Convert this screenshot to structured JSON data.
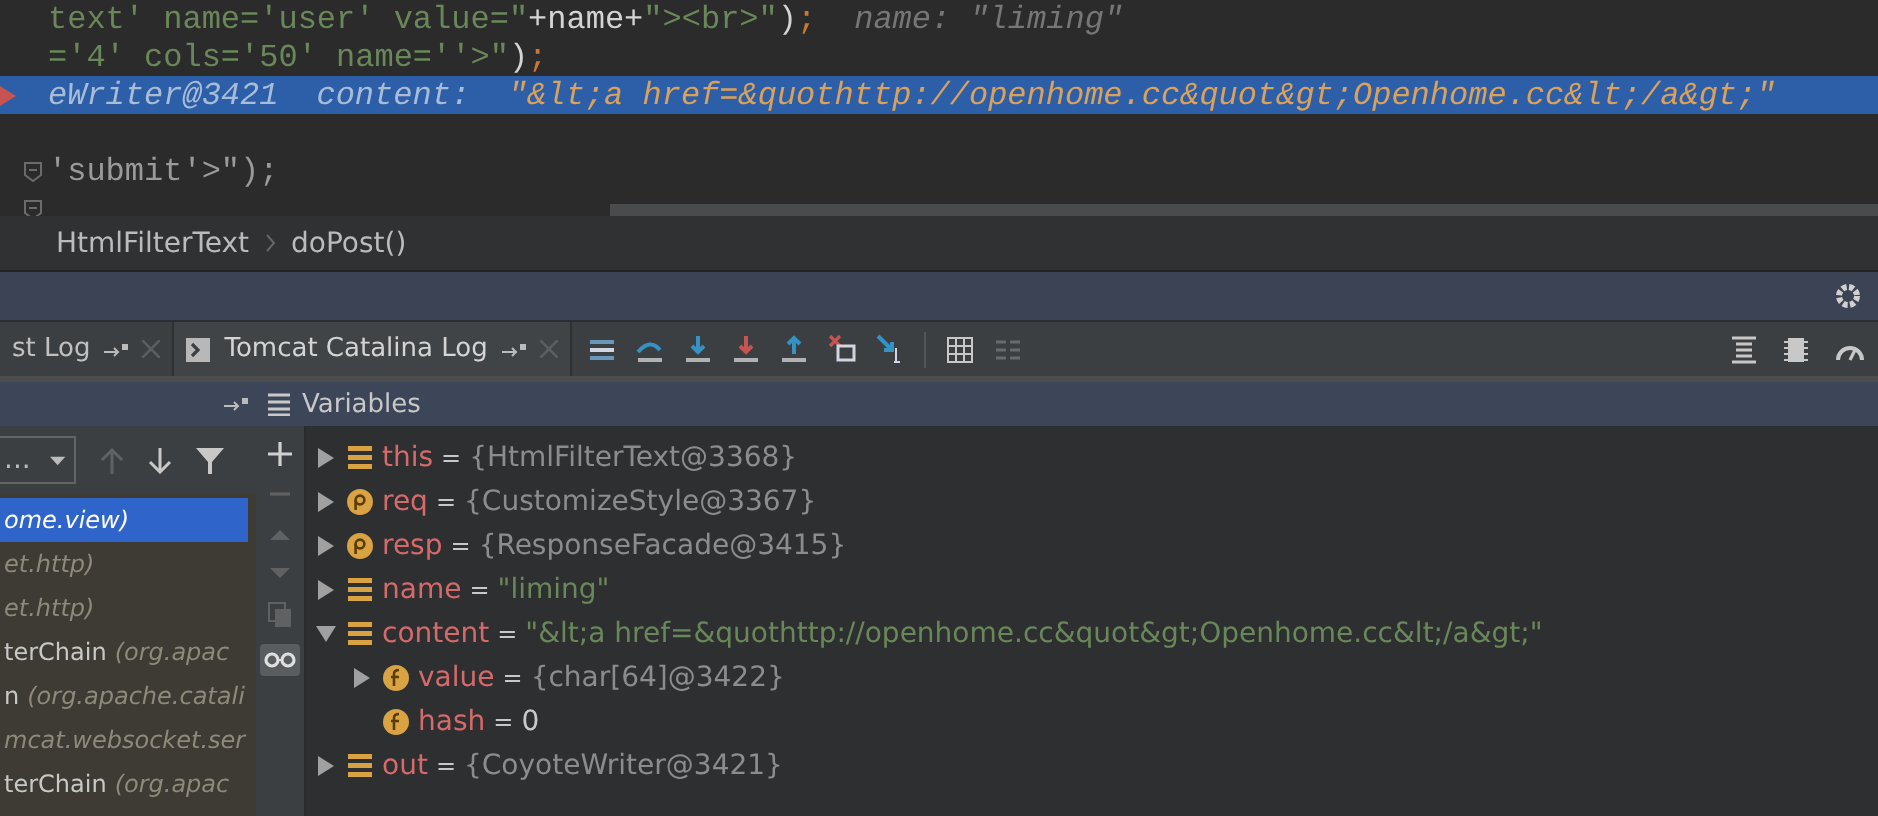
{
  "editor": {
    "lines": [
      {
        "selected": false,
        "breakpoint": false,
        "fold": false,
        "segments": [
          {
            "text": "text' name='user' value=\"",
            "kind": "string"
          },
          {
            "text": "+name+",
            "kind": "code"
          },
          {
            "text": "\"><br>\"",
            "kind": "string"
          },
          {
            "text": ")",
            "kind": "code"
          },
          {
            "text": ";",
            "kind": "punct"
          },
          {
            "text": "name: \"liming\"",
            "kind": "hint"
          }
        ]
      },
      {
        "selected": false,
        "breakpoint": false,
        "fold": false,
        "segments": [
          {
            "text": "='4' cols='50' name=''>\"",
            "kind": "string"
          },
          {
            "text": ")",
            "kind": "code"
          },
          {
            "text": ";",
            "kind": "punct"
          }
        ]
      },
      {
        "selected": true,
        "breakpoint": true,
        "fold": false,
        "segments": [
          {
            "text": "eWriter@3421",
            "kind": "debug-label"
          },
          {
            "text": "content:",
            "kind": "debug-label"
          },
          {
            "text": "\"&lt;a href=&quothttp://openhome.cc&quot&gt;Openhome.cc&lt;/a&gt;\"",
            "kind": "debug-value"
          }
        ]
      },
      {
        "selected": false,
        "breakpoint": false,
        "fold": false
      },
      {
        "selected": false,
        "breakpoint": false,
        "fold": true,
        "segments": [
          {
            "text": "'submit'>\");",
            "kind": "dim"
          }
        ]
      },
      {
        "selected": false,
        "breakpoint": false,
        "fold": true
      }
    ]
  },
  "breadcrumb": [
    "HtmlFilterText",
    "doPost()"
  ],
  "tabs": [
    {
      "label": "st Log",
      "selected": false,
      "console": false
    },
    {
      "label": "Tomcat Catalina Log",
      "selected": true,
      "console": true
    }
  ],
  "frames": {
    "dropdown": "...",
    "items": [
      {
        "location": "ome.view)",
        "selected": true
      },
      {
        "location": "et.http)",
        "selected": false
      },
      {
        "location": "et.http)",
        "selected": false
      },
      {
        "method": "terChain",
        "location": "(org.apac",
        "selected": false
      },
      {
        "method": "n",
        "location": "(org.apache.catali",
        "selected": false
      },
      {
        "location": "mcat.websocket.ser",
        "selected": false
      },
      {
        "method": "terChain",
        "location": "(org.apac",
        "selected": false
      }
    ]
  },
  "variables": {
    "title": "Variables",
    "items": [
      {
        "kind": "field",
        "name": "this",
        "equals": "=",
        "value": {
          "text": "{HtmlFilterText@3368}",
          "kind": "object"
        },
        "expanded": false
      },
      {
        "kind": "param",
        "name": "req",
        "equals": "=",
        "value": {
          "text": "{CustomizeStyle@3367}",
          "kind": "object"
        },
        "expanded": false
      },
      {
        "kind": "param",
        "name": "resp",
        "equals": "=",
        "value": {
          "text": "{ResponseFacade@3415}",
          "kind": "object"
        },
        "expanded": false
      },
      {
        "kind": "field",
        "name": "name",
        "equals": "=",
        "value": {
          "text": "\"liming\"",
          "kind": "string"
        },
        "expanded": false
      },
      {
        "kind": "field",
        "name": "content",
        "equals": "=",
        "value": {
          "text": "\"&lt;a href=&quothttp://openhome.cc&quot&gt;Openhome.cc&lt;/a&gt;\"",
          "kind": "string"
        },
        "expanded": true,
        "children": [
          {
            "kind": "final-field",
            "name": "value",
            "equals": "=",
            "value": {
              "text": "{char[64]@3422}",
              "kind": "object"
            },
            "expanded": false
          },
          {
            "kind": "final-field",
            "name": "hash",
            "equals": "=",
            "value": {
              "text": "0",
              "kind": "number"
            }
          }
        ]
      },
      {
        "kind": "field",
        "name": "out",
        "equals": "=",
        "value": {
          "text": "{CoyoteWriter@3421}",
          "kind": "object"
        },
        "expanded": false
      }
    ]
  }
}
